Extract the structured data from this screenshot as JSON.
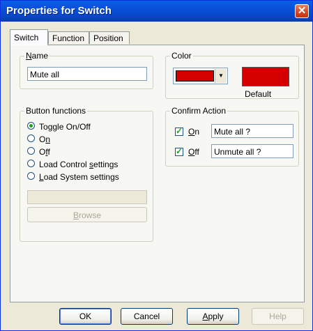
{
  "window": {
    "title": "Properties for Switch",
    "close_glyph": "✕"
  },
  "tabs": [
    {
      "label": "Switch",
      "active": true
    },
    {
      "label": "Function",
      "active": false
    },
    {
      "label": "Position",
      "active": false
    }
  ],
  "name_group": {
    "legend_mnemonic": "N",
    "legend_rest": "ame",
    "value": "Mute all"
  },
  "color_group": {
    "legend": "Color",
    "selected_color": "#d40000",
    "default_color": "#d40000",
    "dropdown_icon": "▼",
    "default_label": "Default"
  },
  "button_functions": {
    "legend": "Button functions",
    "options": [
      {
        "pre": "To",
        "mnemonic": "g",
        "post": "gle On/Off",
        "checked": true
      },
      {
        "pre": "O",
        "mnemonic": "n",
        "post": "",
        "checked": false
      },
      {
        "pre": "O",
        "mnemonic": "f",
        "post": "f",
        "checked": false
      },
      {
        "pre": "Load Control ",
        "mnemonic": "s",
        "post": "ettings",
        "checked": false
      },
      {
        "pre": "",
        "mnemonic": "L",
        "post": "oad System settings",
        "checked": false
      }
    ],
    "path_value": "",
    "browse_mnemonic": "B",
    "browse_rest": "rowse"
  },
  "confirm_action": {
    "legend": "Confirm Action",
    "on": {
      "mnemonic": "O",
      "rest": "n",
      "checked": true,
      "message": "Mute all ?"
    },
    "off": {
      "mnemonic": "O",
      "rest": "ff",
      "checked": true,
      "message": "Unmute all ?"
    }
  },
  "footer": {
    "ok": "OK",
    "cancel": "Cancel",
    "apply_mnemonic": "A",
    "apply_rest": "pply",
    "help": "Help"
  }
}
